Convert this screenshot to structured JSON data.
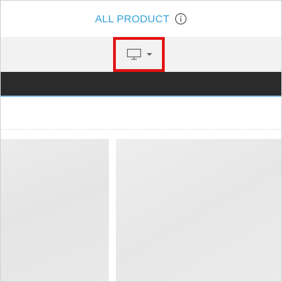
{
  "header": {
    "title": "ALL PRODUCT",
    "info_icon": "info-icon",
    "title_color": "#35a3d6"
  },
  "toolbar": {
    "device_picker": {
      "selected_icon": "desktop-monitor-icon",
      "dropdown_icon": "caret-down-icon",
      "highlight_color": "#e31414"
    }
  },
  "colors": {
    "dark_bar": "#2b2b2b",
    "toolbar_bg": "#f2f2f2"
  },
  "grid": {
    "tiles": [
      {
        "name": "product-tile-1"
      },
      {
        "name": "product-tile-2"
      }
    ]
  }
}
